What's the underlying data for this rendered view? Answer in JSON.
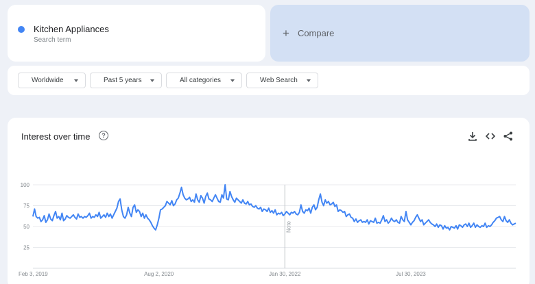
{
  "search_term": {
    "name": "Kitchen Appliances",
    "type_label": "Search term",
    "color": "#4285f4"
  },
  "compare": {
    "label": "Compare",
    "icon": "plus-icon"
  },
  "filters": [
    {
      "label": "Worldwide"
    },
    {
      "label": "Past 5 years"
    },
    {
      "label": "All categories"
    },
    {
      "label": "Web Search"
    }
  ],
  "chart_panel": {
    "title": "Interest over time",
    "icons": [
      "help-icon",
      "download-icon",
      "embed-code-icon",
      "share-icon"
    ]
  },
  "chart_data": {
    "type": "line",
    "title": "Interest over time",
    "xlabel": "",
    "ylabel": "",
    "ylim": [
      0,
      100
    ],
    "y_ticks": [
      "100",
      "75",
      "50",
      "25"
    ],
    "x_ticks": [
      "Feb 3, 2019",
      "Aug 2, 2020",
      "Jan 30, 2022",
      "Jul 30, 2023"
    ],
    "grid": true,
    "note_label": "Note",
    "series": [
      {
        "color": "#4285f4",
        "x_start": "2019-02-03",
        "interval": "week",
        "values": [
          62,
          71,
          62,
          60,
          61,
          56,
          58,
          63,
          55,
          58,
          65,
          59,
          57,
          63,
          68,
          60,
          62,
          58,
          66,
          57,
          59,
          63,
          61,
          60,
          62,
          64,
          61,
          59,
          65,
          61,
          62,
          60,
          62,
          61,
          63,
          66,
          60,
          62,
          61,
          64,
          62,
          67,
          60,
          62,
          64,
          61,
          66,
          62,
          65,
          60,
          64,
          68,
          72,
          80,
          83,
          70,
          62,
          60,
          64,
          73,
          66,
          62,
          73,
          76,
          67,
          70,
          68,
          62,
          66,
          60,
          64,
          60,
          58,
          55,
          51,
          48,
          46,
          52,
          60,
          70,
          71,
          73,
          75,
          80,
          78,
          76,
          81,
          75,
          77,
          82,
          84,
          90,
          97,
          88,
          84,
          82,
          83,
          85,
          80,
          82,
          79,
          89,
          82,
          79,
          87,
          84,
          78,
          86,
          90,
          83,
          82,
          80,
          84,
          88,
          84,
          80,
          79,
          88,
          84,
          100,
          83,
          82,
          92,
          86,
          82,
          79,
          84,
          82,
          80,
          78,
          82,
          78,
          77,
          80,
          76,
          77,
          74,
          73,
          75,
          72,
          71,
          73,
          68,
          71,
          70,
          68,
          72,
          67,
          69,
          66,
          70,
          64,
          66,
          65,
          67,
          63,
          65,
          68,
          66,
          64,
          67,
          66,
          68,
          65,
          64,
          67,
          76,
          68,
          66,
          70,
          69,
          72,
          66,
          73,
          76,
          70,
          73,
          82,
          89,
          79,
          75,
          82,
          78,
          80,
          76,
          77,
          79,
          74,
          76,
          68,
          70,
          69,
          67,
          68,
          62,
          64,
          65,
          61,
          60,
          56,
          59,
          55,
          57,
          58,
          55,
          56,
          55,
          58,
          53,
          57,
          56,
          55,
          60,
          54,
          55,
          54,
          58,
          63,
          56,
          58,
          54,
          56,
          60,
          57,
          56,
          58,
          55,
          54,
          62,
          58,
          56,
          68,
          58,
          55,
          52,
          55,
          57,
          61,
          64,
          60,
          56,
          58,
          52,
          54,
          56,
          58,
          55,
          53,
          52,
          50,
          53,
          49,
          52,
          51,
          47,
          51,
          48,
          49,
          46,
          50,
          49,
          48,
          51,
          47,
          52,
          51,
          49,
          52,
          53,
          50,
          54,
          49,
          51,
          54,
          49,
          52,
          50,
          49,
          51,
          50,
          54,
          49,
          51,
          50,
          52,
          55,
          57,
          60,
          61,
          62,
          58,
          56,
          62,
          57,
          55,
          58,
          54,
          52,
          53,
          54
        ]
      }
    ]
  }
}
